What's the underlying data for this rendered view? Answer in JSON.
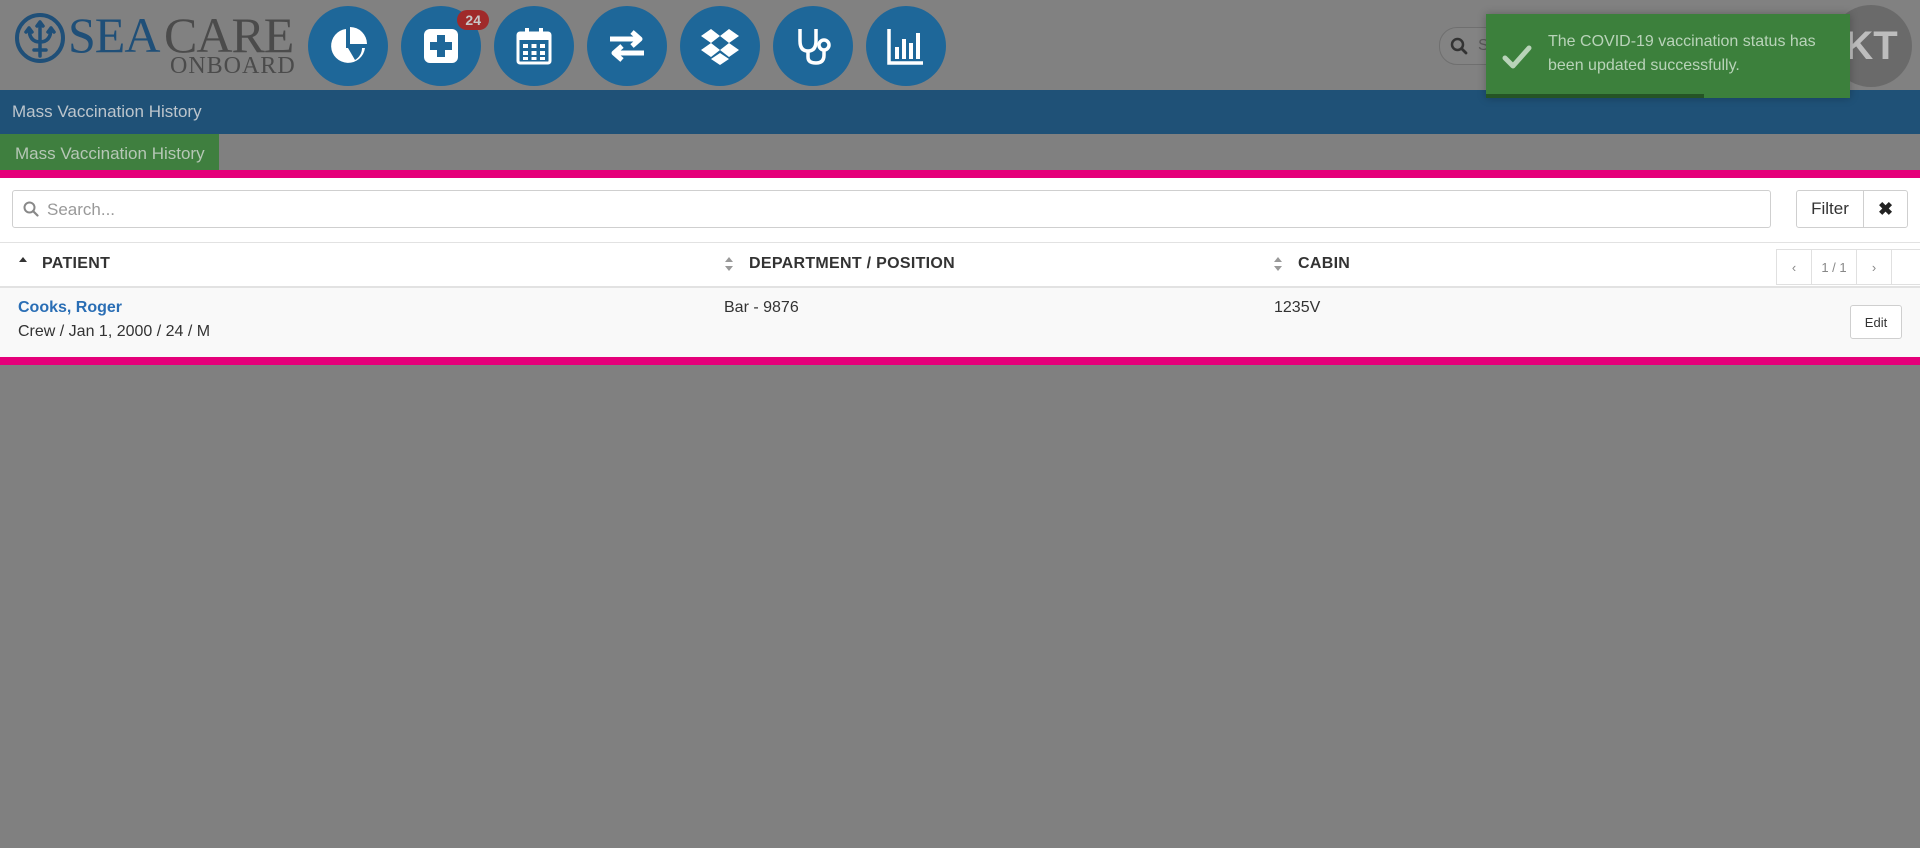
{
  "logo": {
    "sea": "SEA",
    "care": "CARE",
    "onboard": "ONBOARD"
  },
  "nav": [
    {
      "name": "dashboard",
      "icon": "pie-chart-icon"
    },
    {
      "name": "medical",
      "icon": "plus-square-icon",
      "badge": "24"
    },
    {
      "name": "calendar",
      "icon": "calendar-icon"
    },
    {
      "name": "transfer",
      "icon": "exchange-icon"
    },
    {
      "name": "dropbox",
      "icon": "dropbox-icon"
    },
    {
      "name": "clinic",
      "icon": "stethoscope-icon"
    },
    {
      "name": "reports",
      "icon": "bar-chart-icon"
    }
  ],
  "top_search": {
    "placeholder": "S"
  },
  "user": {
    "initials": "KT"
  },
  "page": {
    "title": "Mass Vaccination History",
    "tab": "Mass Vaccination History"
  },
  "search": {
    "placeholder": "Search...",
    "value": ""
  },
  "filter_label": "Filter",
  "clear_icon": "✖",
  "columns": {
    "patient": "PATIENT",
    "department": "DEPARTMENT / POSITION",
    "cabin": "CABIN"
  },
  "pagination": {
    "prev": "‹",
    "info": "1 / 1",
    "next": "›"
  },
  "rows": [
    {
      "name": "Cooks, Roger",
      "details": "Crew / Jan 1, 2000 / 24 / M",
      "department": "Bar - 9876",
      "cabin": "1235V",
      "action": "Edit"
    }
  ],
  "toast": {
    "message": "The COVID-19 vaccination status has been updated successfully.",
    "progress": 0.6
  },
  "colors": {
    "overlay_bg": "#808080",
    "brand_blue": "#1e6799",
    "highlight": "#e5007a",
    "success": "#3c803c",
    "link": "#2a6eb5"
  }
}
